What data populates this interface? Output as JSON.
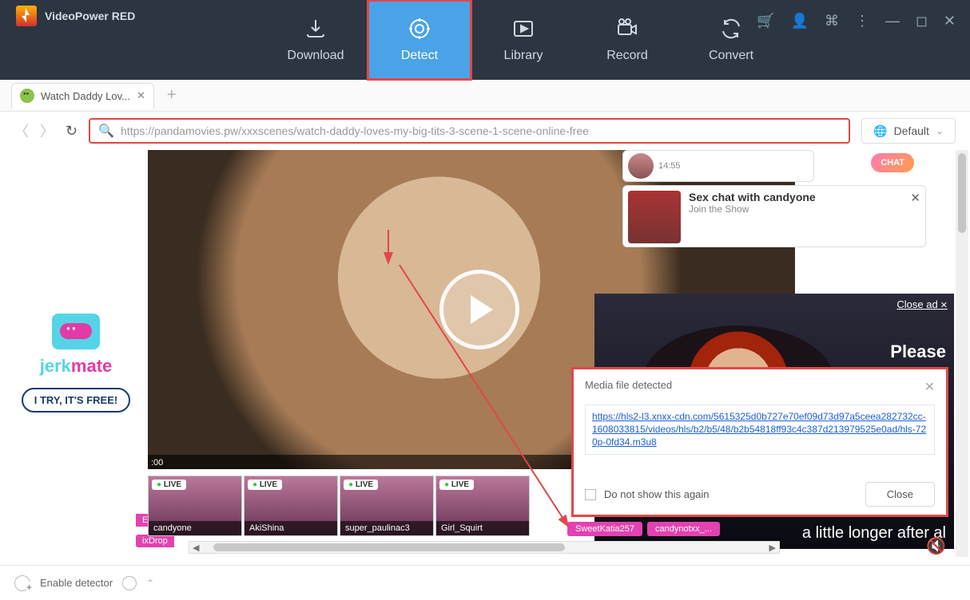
{
  "app": {
    "title": "VideoPower RED"
  },
  "nav": {
    "tabs": [
      {
        "label": "Download"
      },
      {
        "label": "Detect"
      },
      {
        "label": "Library"
      },
      {
        "label": "Record"
      },
      {
        "label": "Convert"
      }
    ],
    "selected": 1
  },
  "browser": {
    "tab_title": "Watch Daddy Lov...",
    "url": "https://pandamovies.pw/xxxscenes/watch-daddy-loves-my-big-tits-3-scene-1-scene-online-free",
    "language": "Default"
  },
  "video": {
    "time": ":00"
  },
  "promo": {
    "brand_j": "jerk",
    "brand_mate": "mate",
    "cta": "I TRY, IT'S FREE!"
  },
  "ads": {
    "chat_badge": "CHAT",
    "card1_time": "14:55",
    "card2_title": "Sex chat with candyone",
    "card2_sub": "Join the Show",
    "big_close": "Close ad",
    "big_headline": "Please",
    "big_caption": "a little longer after al"
  },
  "live": {
    "pill1": "ETU",
    "pill2": "ixDrop",
    "cards": [
      {
        "badge": "LIVE",
        "name": "candyone"
      },
      {
        "badge": "LIVE",
        "name": "AkiShina"
      },
      {
        "badge": "LIVE",
        "name": "super_paulinac3"
      },
      {
        "badge": "LIVE",
        "name": "Girl_Squirt"
      }
    ],
    "tags": [
      "SweetKatia257",
      "candynotxx_..."
    ]
  },
  "dialog": {
    "title": "Media file detected",
    "url": "https://hls2-l3.xnxx-cdn.com/5615325d0b727e70ef09d73d97a5ceea282732cc-1608033815/videos/hls/b2/b5/48/b2b54818ff93c4c387d213979525e0ad/hls-720p-0fd34.m3u8",
    "checkbox": "Do not show this again",
    "button": "Close"
  },
  "statusbar": {
    "enable_detector": "Enable detector"
  }
}
